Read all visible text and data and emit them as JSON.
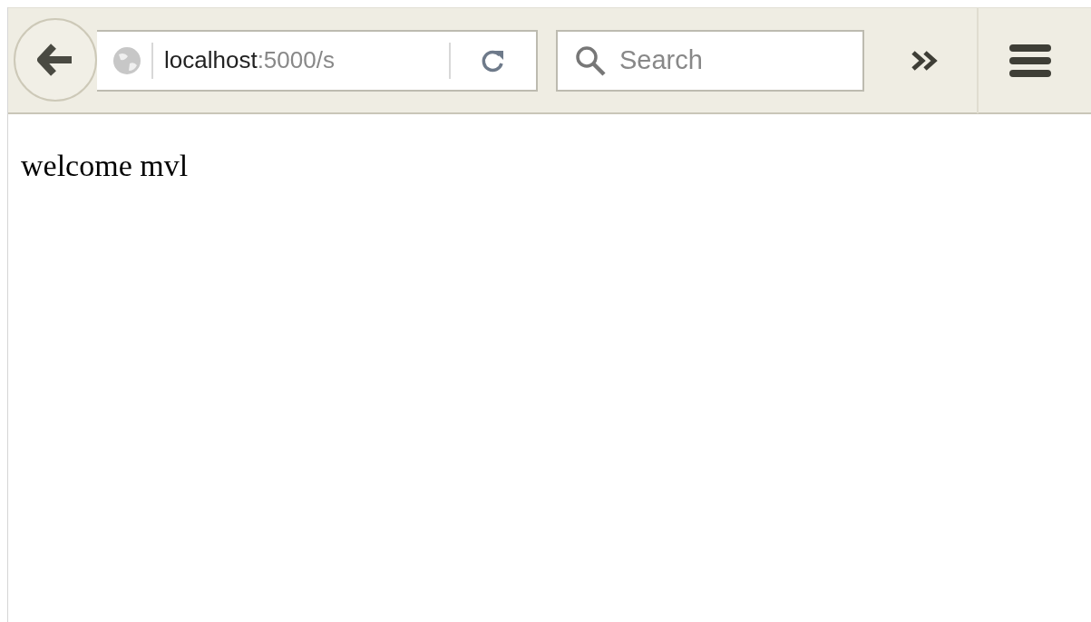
{
  "toolbar": {
    "url": {
      "host": "localhost",
      "rest": ":5000/s"
    },
    "search": {
      "placeholder": "Search"
    }
  },
  "page": {
    "text": "welcome mvl"
  }
}
